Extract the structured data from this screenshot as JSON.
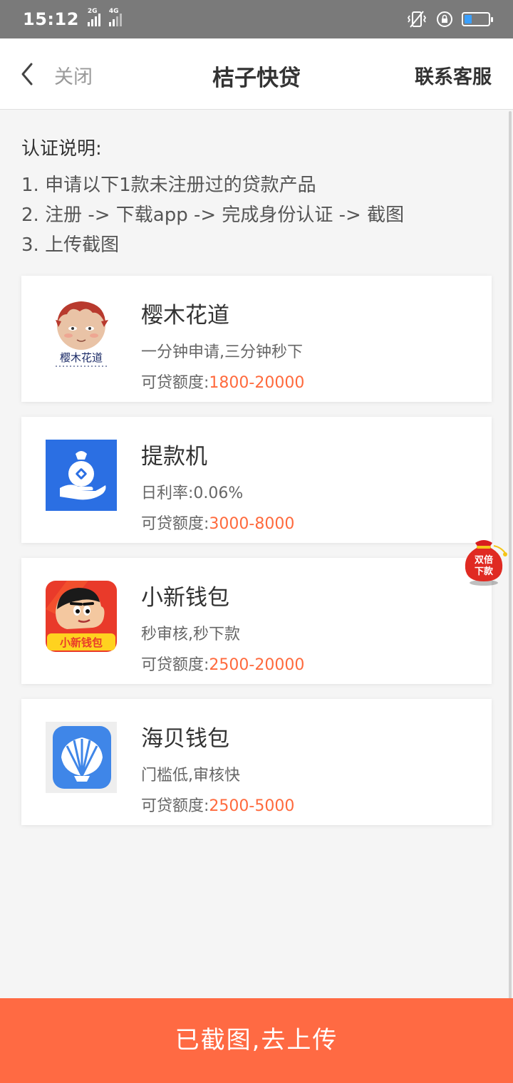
{
  "status_bar": {
    "time": "15:12",
    "sim1": "2G",
    "sim2": "4G",
    "battery_level": 0.3
  },
  "nav": {
    "back_icon": "chevron-left-icon",
    "close_label": "关闭",
    "title": "桔子快贷",
    "service_label": "联系客服"
  },
  "instructions": {
    "title": "认证说明:",
    "lines": [
      "1. 申请以下1款未注册过的贷款产品",
      "2. 注册 -> 下载app -> 完成身份认证 -> 截图",
      "3. 上传截图"
    ]
  },
  "products": [
    {
      "name": "樱木花道",
      "desc": "一分钟申请,三分钟秒下",
      "limit_label": "可贷额度:",
      "limit_value": "1800-20000",
      "logo_text": "樱木花道"
    },
    {
      "name": "提款机",
      "desc": "日利率:0.06%",
      "limit_label": "可贷额度:",
      "limit_value": "3000-8000"
    },
    {
      "name": "小新钱包",
      "desc": "秒审核,秒下款",
      "limit_label": "可贷额度:",
      "limit_value": "2500-20000",
      "logo_text": "小新钱包"
    },
    {
      "name": "海贝钱包",
      "desc": "门槛低,审核快",
      "limit_label": "可贷额度:",
      "limit_value": "2500-5000"
    }
  ],
  "float_badge": {
    "line1": "双倍",
    "line2": "下款"
  },
  "bottom_button": {
    "label": "已截图,去上传"
  },
  "colors": {
    "accent": "#ff6a43",
    "limit_value": "#ff6a3d",
    "status_bar": "#7a7a7a"
  }
}
